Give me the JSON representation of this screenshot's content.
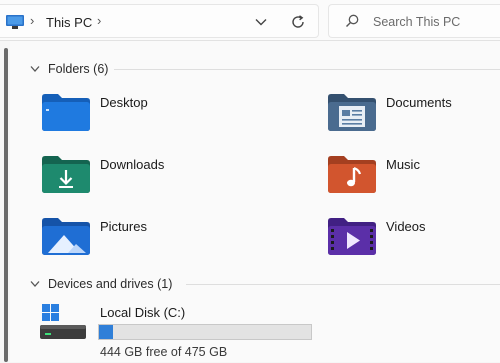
{
  "address_bar": {
    "breadcrumb": "This PC",
    "search_placeholder": "Search This PC"
  },
  "groups": {
    "folders": {
      "header": "Folders (6)",
      "items": [
        {
          "label": "Desktop",
          "icon": "desktop-folder-icon"
        },
        {
          "label": "Documents",
          "icon": "documents-folder-icon"
        },
        {
          "label": "Downloads",
          "icon": "downloads-folder-icon"
        },
        {
          "label": "Music",
          "icon": "music-folder-icon"
        },
        {
          "label": "Pictures",
          "icon": "pictures-folder-icon"
        },
        {
          "label": "Videos",
          "icon": "videos-folder-icon"
        }
      ]
    },
    "drives": {
      "header": "Devices and drives (1)",
      "items": [
        {
          "label": "Local Disk (C:)",
          "free_text": "444 GB free of 475 GB",
          "used_fraction": 0.065,
          "icon": "local-disk-icon"
        }
      ]
    }
  },
  "colors": {
    "accent": "#2f7fd8",
    "desktop": "#1f7ae0",
    "documents": "#4a6b8f",
    "downloads": "#1e8a6e",
    "music": "#d2552e",
    "pictures": "#1f6ed4",
    "videos": "#5b2fa8"
  }
}
